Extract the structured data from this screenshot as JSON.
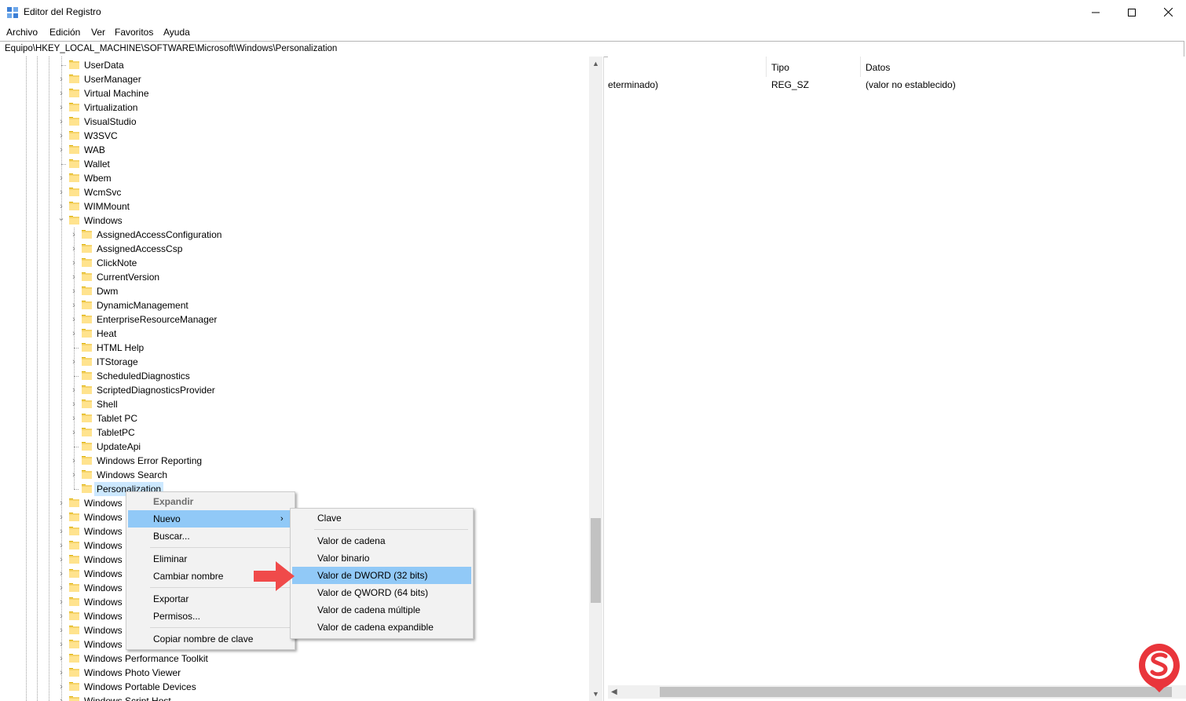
{
  "window": {
    "title": "Editor del Registro",
    "icon": "registry-icon",
    "buttons": [
      "minimize-icon",
      "maximize-icon",
      "close-icon"
    ]
  },
  "menubar": {
    "items": [
      "Archivo",
      "Edición",
      "Ver",
      "Favoritos",
      "Ayuda"
    ]
  },
  "address": {
    "path": "Equipo\\HKEY_LOCAL_MACHINE\\SOFTWARE\\Microsoft\\Windows\\Personalization"
  },
  "tree": {
    "items": [
      {
        "label": "UserData",
        "level": 1,
        "expander": "none"
      },
      {
        "label": "UserManager",
        "level": 1,
        "expander": "collapsed"
      },
      {
        "label": "Virtual Machine",
        "level": 1,
        "expander": "collapsed"
      },
      {
        "label": "Virtualization",
        "level": 1,
        "expander": "collapsed"
      },
      {
        "label": "VisualStudio",
        "level": 1,
        "expander": "collapsed"
      },
      {
        "label": "W3SVC",
        "level": 1,
        "expander": "collapsed"
      },
      {
        "label": "WAB",
        "level": 1,
        "expander": "collapsed"
      },
      {
        "label": "Wallet",
        "level": 1,
        "expander": "none"
      },
      {
        "label": "Wbem",
        "level": 1,
        "expander": "collapsed"
      },
      {
        "label": "WcmSvc",
        "level": 1,
        "expander": "collapsed"
      },
      {
        "label": "WIMMount",
        "level": 1,
        "expander": "collapsed"
      },
      {
        "label": "Windows",
        "level": 1,
        "expander": "expanded"
      },
      {
        "label": "AssignedAccessConfiguration",
        "level": 2,
        "expander": "collapsed"
      },
      {
        "label": "AssignedAccessCsp",
        "level": 2,
        "expander": "collapsed"
      },
      {
        "label": "ClickNote",
        "level": 2,
        "expander": "collapsed"
      },
      {
        "label": "CurrentVersion",
        "level": 2,
        "expander": "collapsed"
      },
      {
        "label": "Dwm",
        "level": 2,
        "expander": "collapsed"
      },
      {
        "label": "DynamicManagement",
        "level": 2,
        "expander": "collapsed"
      },
      {
        "label": "EnterpriseResourceManager",
        "level": 2,
        "expander": "collapsed"
      },
      {
        "label": "Heat",
        "level": 2,
        "expander": "collapsed"
      },
      {
        "label": "HTML Help",
        "level": 2,
        "expander": "none"
      },
      {
        "label": "ITStorage",
        "level": 2,
        "expander": "collapsed"
      },
      {
        "label": "ScheduledDiagnostics",
        "level": 2,
        "expander": "none"
      },
      {
        "label": "ScriptedDiagnosticsProvider",
        "level": 2,
        "expander": "collapsed"
      },
      {
        "label": "Shell",
        "level": 2,
        "expander": "collapsed"
      },
      {
        "label": "Tablet PC",
        "level": 2,
        "expander": "collapsed"
      },
      {
        "label": "TabletPC",
        "level": 2,
        "expander": "collapsed"
      },
      {
        "label": "UpdateApi",
        "level": 2,
        "expander": "none"
      },
      {
        "label": "Windows Error Reporting",
        "level": 2,
        "expander": "collapsed"
      },
      {
        "label": "Windows Search",
        "level": 2,
        "expander": "collapsed"
      },
      {
        "label": "Personalization",
        "level": 2,
        "expander": "none",
        "selected": true
      },
      {
        "label": "Windows",
        "level": 1,
        "expander": "collapsed"
      },
      {
        "label": "Windows",
        "level": 1,
        "expander": "collapsed"
      },
      {
        "label": "Windows",
        "level": 1,
        "expander": "collapsed"
      },
      {
        "label": "Windows",
        "level": 1,
        "expander": "collapsed"
      },
      {
        "label": "Windows",
        "level": 1,
        "expander": "collapsed"
      },
      {
        "label": "Windows",
        "level": 1,
        "expander": "collapsed"
      },
      {
        "label": "Windows",
        "level": 1,
        "expander": "collapsed"
      },
      {
        "label": "Windows",
        "level": 1,
        "expander": "collapsed"
      },
      {
        "label": "Windows",
        "level": 1,
        "expander": "collapsed"
      },
      {
        "label": "Windows",
        "level": 1,
        "expander": "collapsed"
      },
      {
        "label": "Windows",
        "level": 1,
        "expander": "collapsed"
      },
      {
        "label": "Windows Performance Toolkit",
        "level": 1,
        "expander": "collapsed"
      },
      {
        "label": "Windows Photo Viewer",
        "level": 1,
        "expander": "collapsed"
      },
      {
        "label": "Windows Portable Devices",
        "level": 1,
        "expander": "collapsed"
      },
      {
        "label": "Windows Script Host",
        "level": 1,
        "expander": "collapsed"
      }
    ]
  },
  "values": {
    "columns": {
      "name": "",
      "type": "Tipo",
      "data": "Datos"
    },
    "rows": [
      {
        "name": "eterminado)",
        "type": "REG_SZ",
        "data": "(valor no establecido)"
      }
    ]
  },
  "context_menu": {
    "items": [
      {
        "label": "Expandir",
        "state": "disabled"
      },
      {
        "label": "Nuevo",
        "state": "highlighted",
        "submenu": true
      },
      {
        "label": "Buscar..."
      },
      {
        "label": "Eliminar"
      },
      {
        "label": "Cambiar nombre"
      },
      {
        "label": "Exportar"
      },
      {
        "label": "Permisos..."
      },
      {
        "label": "Copiar nombre de clave"
      }
    ]
  },
  "submenu": {
    "items": [
      {
        "label": "Clave"
      },
      {
        "label": "Valor de cadena"
      },
      {
        "label": "Valor binario"
      },
      {
        "label": "Valor de DWORD (32 bits)",
        "state": "highlighted"
      },
      {
        "label": "Valor de QWORD (64 bits)"
      },
      {
        "label": "Valor de cadena múltiple"
      },
      {
        "label": "Valor de cadena expandible"
      }
    ]
  },
  "colors": {
    "selection": "#cce8ff",
    "menu_highlight": "#91c9f7",
    "pointer_arrow": "#f04a4a",
    "logo_circle": "#e9353b",
    "folder": "#f5d36a"
  }
}
